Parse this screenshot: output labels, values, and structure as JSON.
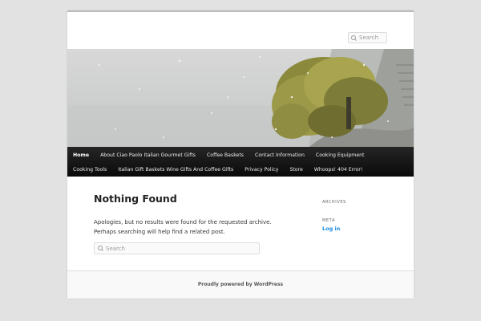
{
  "search": {
    "placeholder": "Search"
  },
  "menu": {
    "row1": [
      "Home",
      "About Ciao Paolo Italian Gourmet Gifts",
      "Coffee Baskets",
      "Contact Information",
      "Cooking Equipment"
    ],
    "row2": [
      "Cooking Tools",
      "Italian Gift Baskets Wine Gifts And Coffee Gifts",
      "Privacy Policy",
      "Store",
      "Whoops! 404 Error!"
    ]
  },
  "main": {
    "title": "Nothing Found",
    "text": "Apologies, but no results were found for the requested archive. Perhaps searching will help find a related post.",
    "search_placeholder": "Search"
  },
  "sidebar": {
    "archives_title": "ARCHIVES",
    "meta_title": "META",
    "login_label": "Log in"
  },
  "footer": {
    "credit": "Proudly powered by WordPress"
  },
  "colors": {
    "link": "#1b8be0",
    "nav_bg": "#111111"
  }
}
